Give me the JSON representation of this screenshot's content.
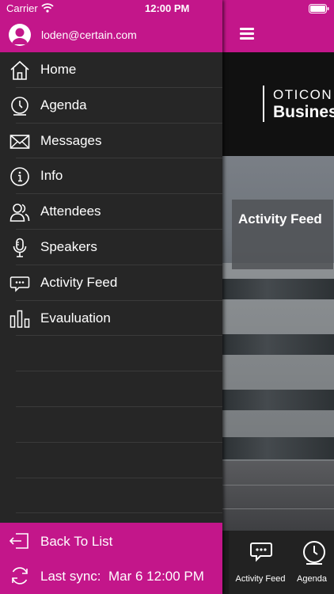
{
  "status_bar": {
    "carrier": "Carrier",
    "time": "12:00 PM"
  },
  "user": {
    "email": "loden@certain.com"
  },
  "menu": {
    "items": [
      {
        "label": "Home",
        "icon": "home-icon"
      },
      {
        "label": "Agenda",
        "icon": "clock-icon"
      },
      {
        "label": "Messages",
        "icon": "envelope-icon"
      },
      {
        "label": "Info",
        "icon": "info-icon"
      },
      {
        "label": "Attendees",
        "icon": "people-icon"
      },
      {
        "label": "Speakers",
        "icon": "microphone-icon"
      },
      {
        "label": "Activity Feed",
        "icon": "chat-bubble-icon"
      },
      {
        "label": "Evauluation",
        "icon": "bar-chart-icon"
      }
    ]
  },
  "footer": {
    "back_label": "Back To List",
    "sync_label": "Last sync:  Mar 6 12:00 PM"
  },
  "main": {
    "brand_top": "OTICON",
    "brand_bottom": "Busines",
    "tile_label": "Activity Feed",
    "tabs": [
      {
        "label": "Activity Feed",
        "icon": "chat-bubble-icon"
      },
      {
        "label": "Agenda",
        "icon": "clock-icon"
      }
    ]
  },
  "colors": {
    "accent": "#c3168a",
    "drawer_bg": "#262626",
    "separator": "#3a3a3a"
  }
}
